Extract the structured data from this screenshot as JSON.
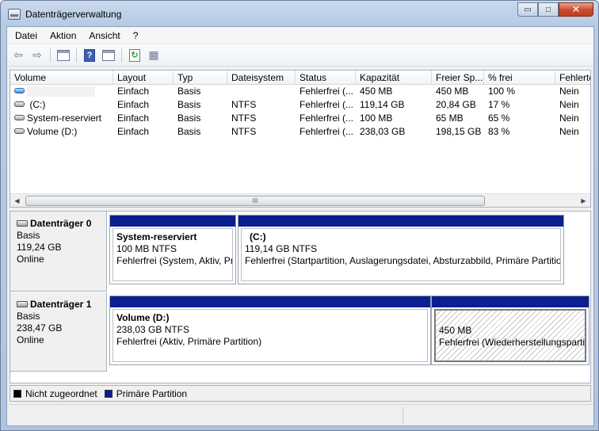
{
  "window": {
    "title": "Datenträgerverwaltung",
    "minimize_glyph": "▭",
    "maximize_glyph": "□",
    "close_glyph": "✕"
  },
  "menu": [
    {
      "label": "Datei"
    },
    {
      "label": "Aktion"
    },
    {
      "label": "Ansicht"
    },
    {
      "label": "?"
    }
  ],
  "toolbar": {
    "back_glyph": "⇦",
    "forward_glyph": "⇨",
    "help_glyph": "?",
    "refresh_glyph": "↻",
    "properties_glyph": "▦"
  },
  "volume_list": {
    "columns": [
      {
        "label": "Volume"
      },
      {
        "label": "Layout"
      },
      {
        "label": "Typ"
      },
      {
        "label": "Dateisystem"
      },
      {
        "label": "Status"
      },
      {
        "label": "Kapazität"
      },
      {
        "label": "Freier Sp..."
      },
      {
        "label": "% frei"
      },
      {
        "label": "Fehlertc"
      }
    ],
    "rows": [
      {
        "icon": "blue-volume-icon",
        "volume": "",
        "layout": "Einfach",
        "typ": "Basis",
        "dateisystem": "",
        "status": "Fehlerfrei (...",
        "kapazitaet": "450 MB",
        "frei": "450 MB",
        "prozent": "100 %",
        "fehler": "Nein"
      },
      {
        "icon": "volume-icon",
        "volume": "(C:)",
        "layout": "Einfach",
        "typ": "Basis",
        "dateisystem": "NTFS",
        "status": "Fehlerfrei (...",
        "kapazitaet": "119,14 GB",
        "frei": "20,84 GB",
        "prozent": "17 %",
        "fehler": "Nein"
      },
      {
        "icon": "volume-icon",
        "volume": "System-reserviert",
        "layout": "Einfach",
        "typ": "Basis",
        "dateisystem": "NTFS",
        "status": "Fehlerfrei (...",
        "kapazitaet": "100 MB",
        "frei": "65 MB",
        "prozent": "65 %",
        "fehler": "Nein"
      },
      {
        "icon": "volume-icon",
        "volume": "Volume (D:)",
        "layout": "Einfach",
        "typ": "Basis",
        "dateisystem": "NTFS",
        "status": "Fehlerfrei (...",
        "kapazitaet": "238,03 GB",
        "frei": "198,15 GB",
        "prozent": "83 %",
        "fehler": "Nein"
      }
    ],
    "scroll_grip": "III"
  },
  "disks": [
    {
      "title": "Datenträger 0",
      "type": "Basis",
      "size": "119,24 GB",
      "state": "Online",
      "partitions": [
        {
          "name": "System-reserviert",
          "size": "100 MB NTFS",
          "status": "Fehlerfrei (System, Aktiv, Pri"
        },
        {
          "name": "(C:)",
          "size": "119,14 GB NTFS",
          "status": "Fehlerfrei (Startpartition, Auslagerungsdatei, Absturzabbild, Primäre Partitio"
        }
      ]
    },
    {
      "title": "Datenträger 1",
      "type": "Basis",
      "size": "238,47 GB",
      "state": "Online",
      "partitions": [
        {
          "name": "Volume  (D:)",
          "size": "238,03 GB NTFS",
          "status": "Fehlerfrei (Aktiv, Primäre Partition)"
        },
        {
          "name": "",
          "size": "450 MB",
          "status": "Fehlerfrei (Wiederherstellungspartit"
        }
      ]
    }
  ],
  "legend": [
    {
      "label": "Nicht zugeordnet",
      "color": "#000000"
    },
    {
      "label": "Primäre Partition",
      "color": "#0b1f8f"
    }
  ],
  "colors": {
    "primary_partition": "#0b1f8f",
    "unallocated": "#000000"
  }
}
